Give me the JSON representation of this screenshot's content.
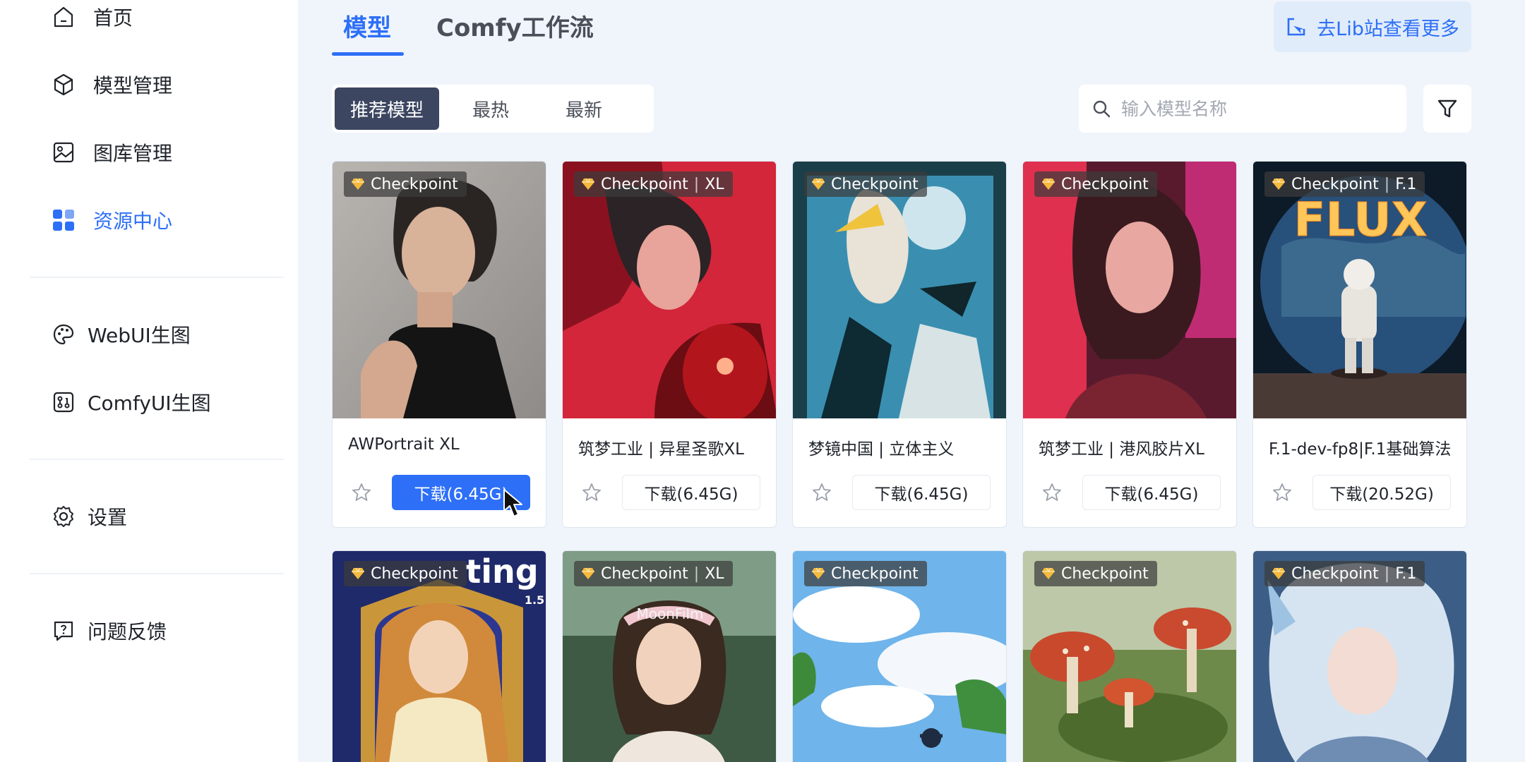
{
  "sidebar": {
    "items": [
      {
        "label": "首页",
        "icon": "home-icon"
      },
      {
        "label": "模型管理",
        "icon": "cube-icon"
      },
      {
        "label": "图库管理",
        "icon": "gallery-icon"
      },
      {
        "label": "资源中心",
        "icon": "grid-apps-icon",
        "active": true
      },
      {
        "label": "WebUI生图",
        "icon": "palette-icon"
      },
      {
        "label": "ComfyUI生图",
        "icon": "workflow-icon"
      },
      {
        "label": "设置",
        "icon": "gear-icon"
      },
      {
        "label": "问题反馈",
        "icon": "feedback-icon"
      }
    ]
  },
  "tabs": [
    {
      "label": "模型",
      "active": true
    },
    {
      "label": "Comfy工作流",
      "active": false
    }
  ],
  "lib_button": {
    "label": "去Lib站查看更多",
    "icon": "external-link-icon"
  },
  "segment": [
    {
      "label": "推荐模型",
      "active": true
    },
    {
      "label": "最热",
      "active": false
    },
    {
      "label": "最新",
      "active": false
    }
  ],
  "search": {
    "placeholder": "输入模型名称",
    "value": ""
  },
  "filter_icon": "filter-icon",
  "colors": {
    "accent": "#2d6ff7",
    "segment_active": "#3c4660",
    "background": "#f0f5fb"
  },
  "cards": [
    {
      "tag": "Checkpoint",
      "tag_suffix": "",
      "title": "AWPortrait XL",
      "download": "下载(6.45G)",
      "highlighted": true
    },
    {
      "tag": "Checkpoint",
      "tag_suffix": "XL",
      "title": "筑梦工业 | 异星圣歌XL",
      "download": "下载(6.45G)"
    },
    {
      "tag": "Checkpoint",
      "tag_suffix": "",
      "title": "梦镜中国 | 立体主义",
      "download": "下载(6.45G)"
    },
    {
      "tag": "Checkpoint",
      "tag_suffix": "",
      "title": "筑梦工业 | 港风胶片XL",
      "download": "下载(6.45G)"
    },
    {
      "tag": "Checkpoint",
      "tag_suffix": "F.1",
      "title": "F.1-dev-fp8|F.1基础算法",
      "download": "下载(20.52G)"
    },
    {
      "tag": "Checkpoint",
      "tag_suffix": "",
      "image_text": "ting",
      "image_subtext": "1.5"
    },
    {
      "tag": "Checkpoint",
      "tag_suffix": "XL",
      "image_text": "MoonFilm"
    },
    {
      "tag": "Checkpoint",
      "tag_suffix": ""
    },
    {
      "tag": "Checkpoint",
      "tag_suffix": ""
    },
    {
      "tag": "Checkpoint",
      "tag_suffix": "F.1"
    }
  ],
  "flux_text": "FLUX"
}
